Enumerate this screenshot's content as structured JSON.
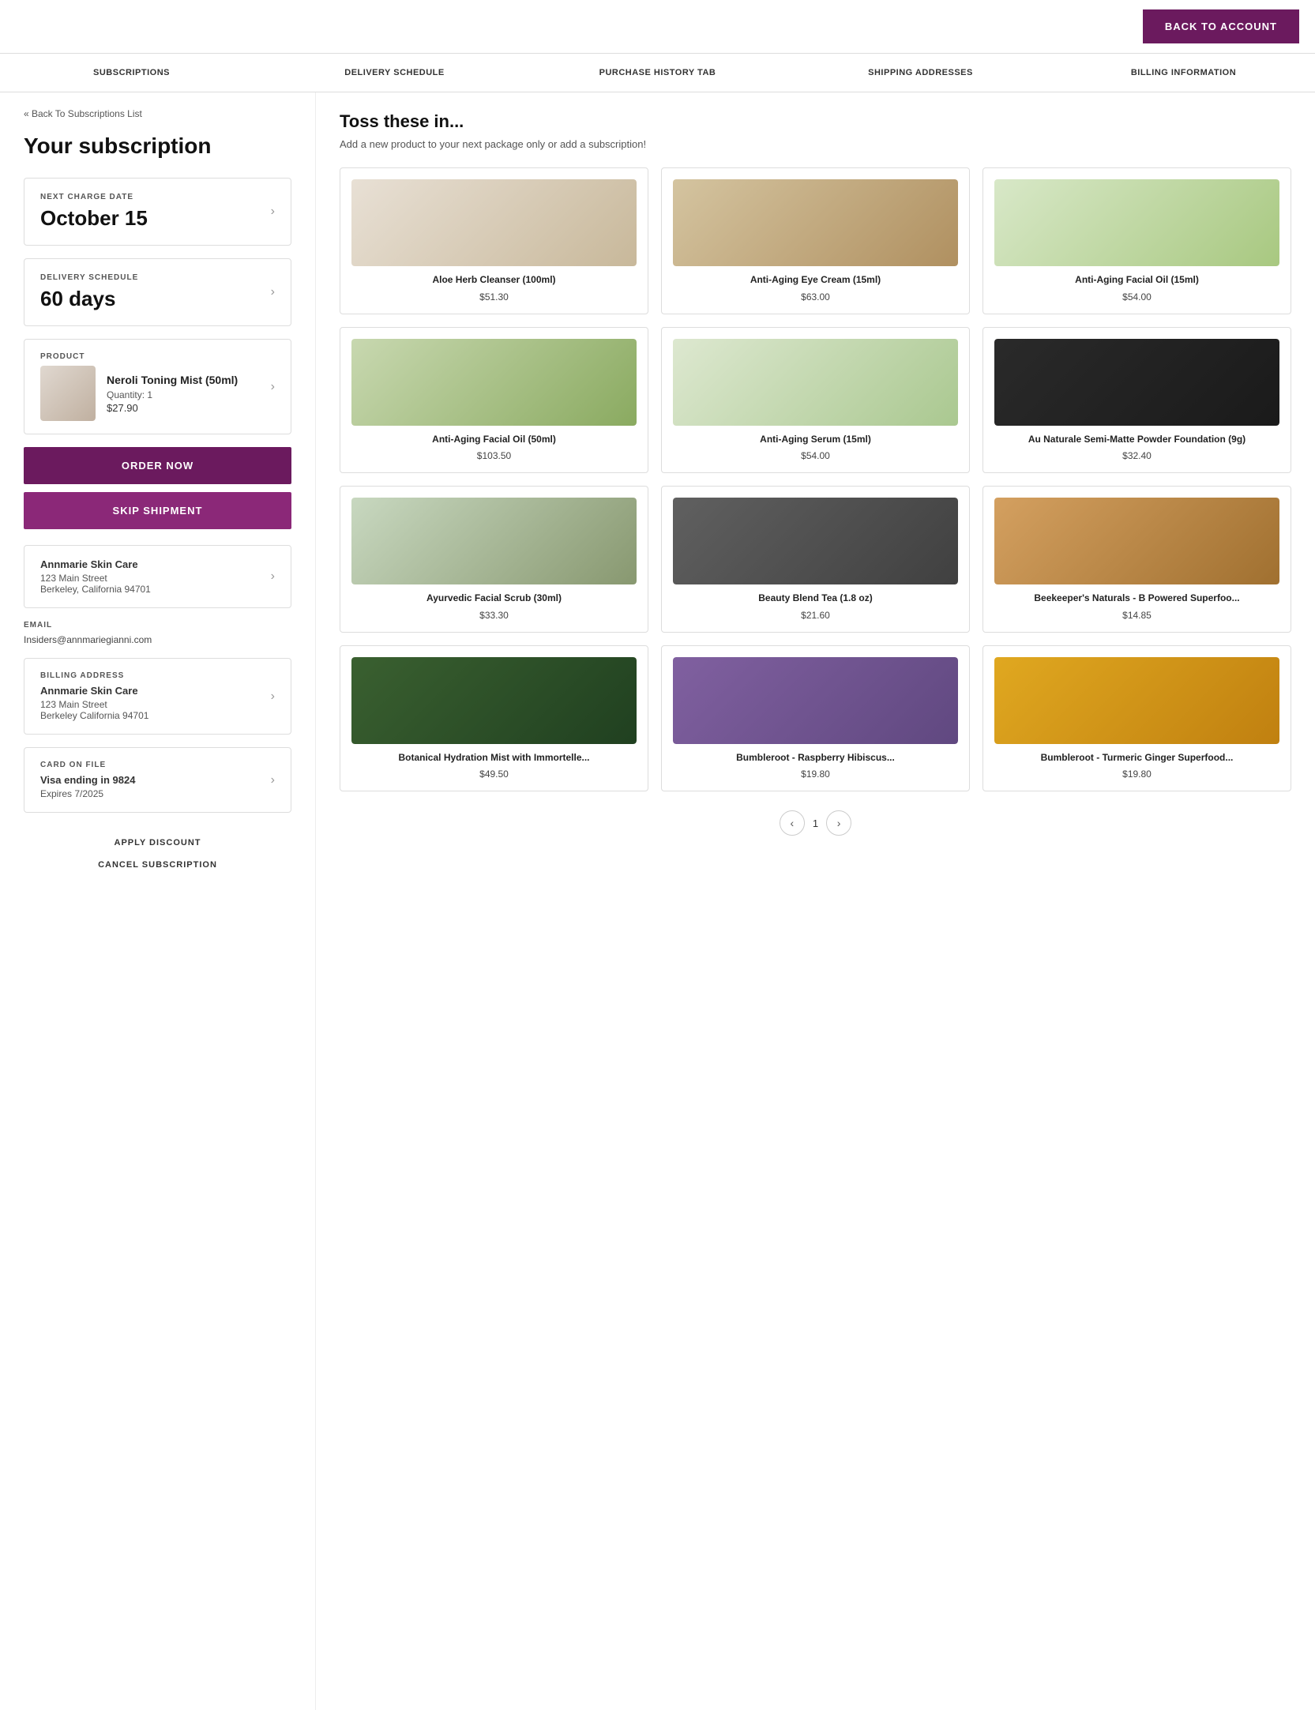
{
  "header": {
    "back_to_account": "BACK TO ACCOUNT"
  },
  "nav": {
    "items": [
      {
        "label": "SUBSCRIPTIONS",
        "id": "subscriptions"
      },
      {
        "label": "DELIVERY SCHEDULE",
        "id": "delivery-schedule"
      },
      {
        "label": "PURCHASE HISTORY TAB",
        "id": "purchase-history"
      },
      {
        "label": "SHIPPING ADDRESSES",
        "id": "shipping-addresses"
      },
      {
        "label": "BILLING INFORMATION",
        "id": "billing-information"
      }
    ]
  },
  "left": {
    "back_link": "« Back To Subscriptions List",
    "page_title": "Your subscription",
    "next_charge": {
      "label": "NEXT CHARGE DATE",
      "value": "October 15"
    },
    "delivery": {
      "label": "DELIVERY SCHEDULE",
      "value": "60 days"
    },
    "product": {
      "label": "PRODUCT",
      "name": "Neroli Toning Mist (50ml)",
      "quantity": "Quantity: 1",
      "price": "$27.90"
    },
    "order_btn": "ORDER NOW",
    "skip_btn": "SKIP SHIPMENT",
    "shipping_address": {
      "name": "Annmarie Skin Care",
      "street": "123 Main Street",
      "city_state_zip": "Berkeley, California 94701"
    },
    "email": {
      "label": "EMAIL",
      "value": "Insiders@annmariegianni.com"
    },
    "billing_address": {
      "label": "BILLING ADDRESS",
      "name": "Annmarie Skin Care",
      "street": "123 Main Street",
      "city_state_zip": "Berkeley California 94701"
    },
    "card_on_file": {
      "label": "CARD ON FILE",
      "card_info": "Visa ending in 9824",
      "expiry": "Expires 7/2025"
    },
    "apply_discount": "APPLY DISCOUNT",
    "cancel_subscription": "CANCEL SUBSCRIPTION"
  },
  "right": {
    "title": "Toss these in...",
    "subtitle": "Add a new product to your next package only or add a subscription!",
    "products": [
      {
        "name": "Aloe Herb Cleanser (100ml)",
        "price": "$51.30",
        "img_class": "img-cleanser"
      },
      {
        "name": "Anti-Aging Eye Cream (15ml)",
        "price": "$63.00",
        "img_class": "img-eyecream"
      },
      {
        "name": "Anti-Aging Facial Oil (15ml)",
        "price": "$54.00",
        "img_class": "img-facialoil1"
      },
      {
        "name": "Anti-Aging Facial Oil (50ml)",
        "price": "$103.50",
        "img_class": "img-facialoil2"
      },
      {
        "name": "Anti-Aging Serum (15ml)",
        "price": "$54.00",
        "img_class": "img-serum"
      },
      {
        "name": "Au Naturale Semi-Matte Powder Foundation (9g)",
        "price": "$32.40",
        "img_class": "img-foundation"
      },
      {
        "name": "Ayurvedic Facial Scrub (30ml)",
        "price": "$33.30",
        "img_class": "img-scrub"
      },
      {
        "name": "Beauty Blend Tea (1.8 oz)",
        "price": "$21.60",
        "img_class": "img-tea"
      },
      {
        "name": "Beekeeper's Naturals - B Powered Superfoo...",
        "price": "$14.85",
        "img_class": "img-bee"
      },
      {
        "name": "Botanical Hydration Mist with Immortelle...",
        "price": "$49.50",
        "img_class": "img-botanical"
      },
      {
        "name": "Bumbleroot - Raspberry Hibiscus...",
        "price": "$19.80",
        "img_class": "img-bumble1"
      },
      {
        "name": "Bumbleroot - Turmeric Ginger Superfood...",
        "price": "$19.80",
        "img_class": "img-bumble2"
      }
    ],
    "pagination": {
      "current_page": "1",
      "prev_label": "‹",
      "next_label": "›"
    }
  }
}
